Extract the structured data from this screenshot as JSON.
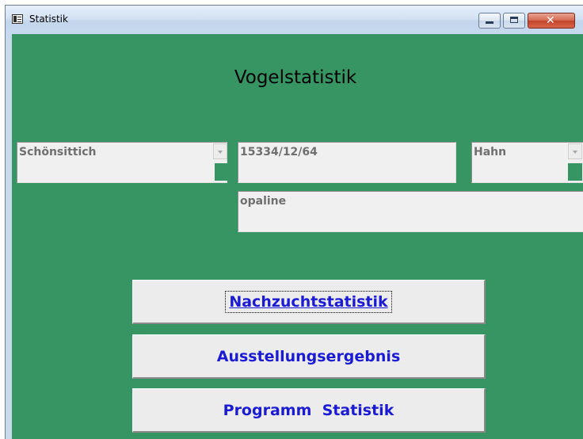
{
  "window": {
    "title": "Statistik"
  },
  "titlebar_buttons": {
    "minimize": "minimize",
    "maximize": "maximize",
    "close": "close"
  },
  "heading": "Vogelstatistik",
  "fields": {
    "species": "Schönsittich",
    "ring_number": "15334/12/64",
    "sex": "Hahn",
    "color_variety": "opaline"
  },
  "buttons": {
    "breeding_statistics": "Nachzuchtstatistik",
    "exhibition_result": "Ausstellungsergebnis",
    "program_statistics": "Programm  Statistik"
  },
  "colors": {
    "background": "#379564",
    "button_text": "#1b1bd4"
  }
}
